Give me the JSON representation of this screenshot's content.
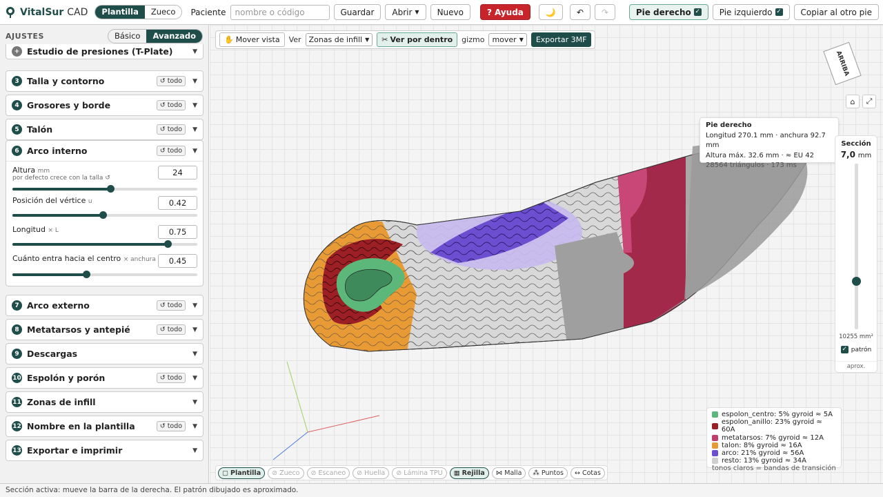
{
  "app": {
    "name": "VitalSur",
    "suffix": "CAD"
  },
  "mode": {
    "plantilla": "Plantilla",
    "zueco": "Zueco"
  },
  "patient": {
    "label": "Paciente",
    "placeholder": "nombre o código"
  },
  "toolbar": {
    "guardar": "Guardar",
    "abrir": "Abrir",
    "nuevo": "Nuevo",
    "ayuda": "Ayuda",
    "pie_derecho": "Pie derecho",
    "pie_izquierdo": "Pie izquierdo",
    "copiar": "Copiar al otro pie"
  },
  "sidebar": {
    "title": "AJUSTES",
    "basico": "Básico",
    "avanzado": "Avanzado"
  },
  "panels": [
    {
      "num": "+",
      "title": "Estudio de presiones (T-Plate)",
      "tag": ""
    },
    {
      "num": "3",
      "title": "Talla y contorno",
      "tag": "↺ todo"
    },
    {
      "num": "4",
      "title": "Grosores y borde",
      "tag": "↺ todo"
    },
    {
      "num": "5",
      "title": "Talón",
      "tag": "↺ todo"
    },
    {
      "num": "6",
      "title": "Arco interno",
      "tag": "↺ todo"
    },
    {
      "num": "7",
      "title": "Arco externo",
      "tag": "↺ todo"
    },
    {
      "num": "8",
      "title": "Metatarsos y antepié",
      "tag": "↺ todo"
    },
    {
      "num": "9",
      "title": "Descargas",
      "tag": ""
    },
    {
      "num": "10",
      "title": "Espolón y porón",
      "tag": "↺ todo"
    },
    {
      "num": "11",
      "title": "Zonas de infill",
      "tag": ""
    },
    {
      "num": "12",
      "title": "Nombre en la plantilla",
      "tag": "↺ todo"
    },
    {
      "num": "13",
      "title": "Exportar e imprimir",
      "tag": ""
    }
  ],
  "arco": {
    "altura": {
      "label": "Altura",
      "unit": "mm",
      "sub": "por defecto crece con la talla",
      "value": "24",
      "fraction": 0.53
    },
    "vertice": {
      "label": "Posición del vértice",
      "unit": "u",
      "value": "0.42",
      "fraction": 0.49
    },
    "longitud": {
      "label": "Longitud",
      "unit": "× L",
      "value": "0.75",
      "fraction": 0.84
    },
    "centro": {
      "label": "Cuánto entra hacia el centro",
      "unit": "× anchura",
      "value": "0.45",
      "fraction": 0.4
    }
  },
  "viewtools": {
    "mover": "Mover vista",
    "ver": "Ver",
    "ver_sel": "Zonas de infill",
    "dentro": "Ver por dentro",
    "gizmo": "gizmo",
    "gizmo_sel": "mover",
    "exportar": "Exportar 3MF"
  },
  "cube": "ARRIBA",
  "info": {
    "title": "Pie derecho",
    "l1": "Longitud 270.1 mm · anchura 92.7 mm",
    "l2": "Altura máx. 32.6 mm · ≈ EU 42",
    "l3": "28564 triángulos · 173 ms"
  },
  "seccion": {
    "title": "Sección",
    "value": "7,0",
    "unit": "mm",
    "area": "10255 mm²",
    "patron": "patrón",
    "aprox": "aprox.",
    "fraction": 0.29
  },
  "legend": [
    {
      "label": "espolon_centro: 5% gyroid ≈ 5A",
      "color": "#5cb87a"
    },
    {
      "label": "espolon_anillo: 23% gyroid ≈ 60A",
      "color": "#9b1f24"
    },
    {
      "label": "metatarsos: 7% gyroid ≈ 12A",
      "color": "#c0406a"
    },
    {
      "label": "talon: 8% gyroid ≈ 16A",
      "color": "#e89a35"
    },
    {
      "label": "arco: 21% gyroid ≈ 56A",
      "color": "#6c4fd0"
    },
    {
      "label": "resto: 13% gyroid ≈ 34A",
      "color": "#cfcfcf"
    }
  ],
  "legend_note": "tonos claros = bandas de transición",
  "layers": [
    {
      "label": "Plantilla",
      "state": "on",
      "icon": "▢"
    },
    {
      "label": "Zueco",
      "state": "off",
      "icon": "⊘"
    },
    {
      "label": "Escaneo",
      "state": "off",
      "icon": "⊘"
    },
    {
      "label": "Huella",
      "state": "off",
      "icon": "⊘"
    },
    {
      "label": "Lámina TPU",
      "state": "off",
      "icon": "⊘"
    },
    {
      "label": "Rejilla",
      "state": "on",
      "icon": "▦"
    },
    {
      "label": "Malla",
      "state": "",
      "icon": "⋈"
    },
    {
      "label": "Puntos",
      "state": "",
      "icon": "⁂"
    },
    {
      "label": "Cotas",
      "state": "",
      "icon": "↔"
    }
  ],
  "status": "Sección activa: mueve la barra de la derecha. El patrón dibujado es aproximado."
}
